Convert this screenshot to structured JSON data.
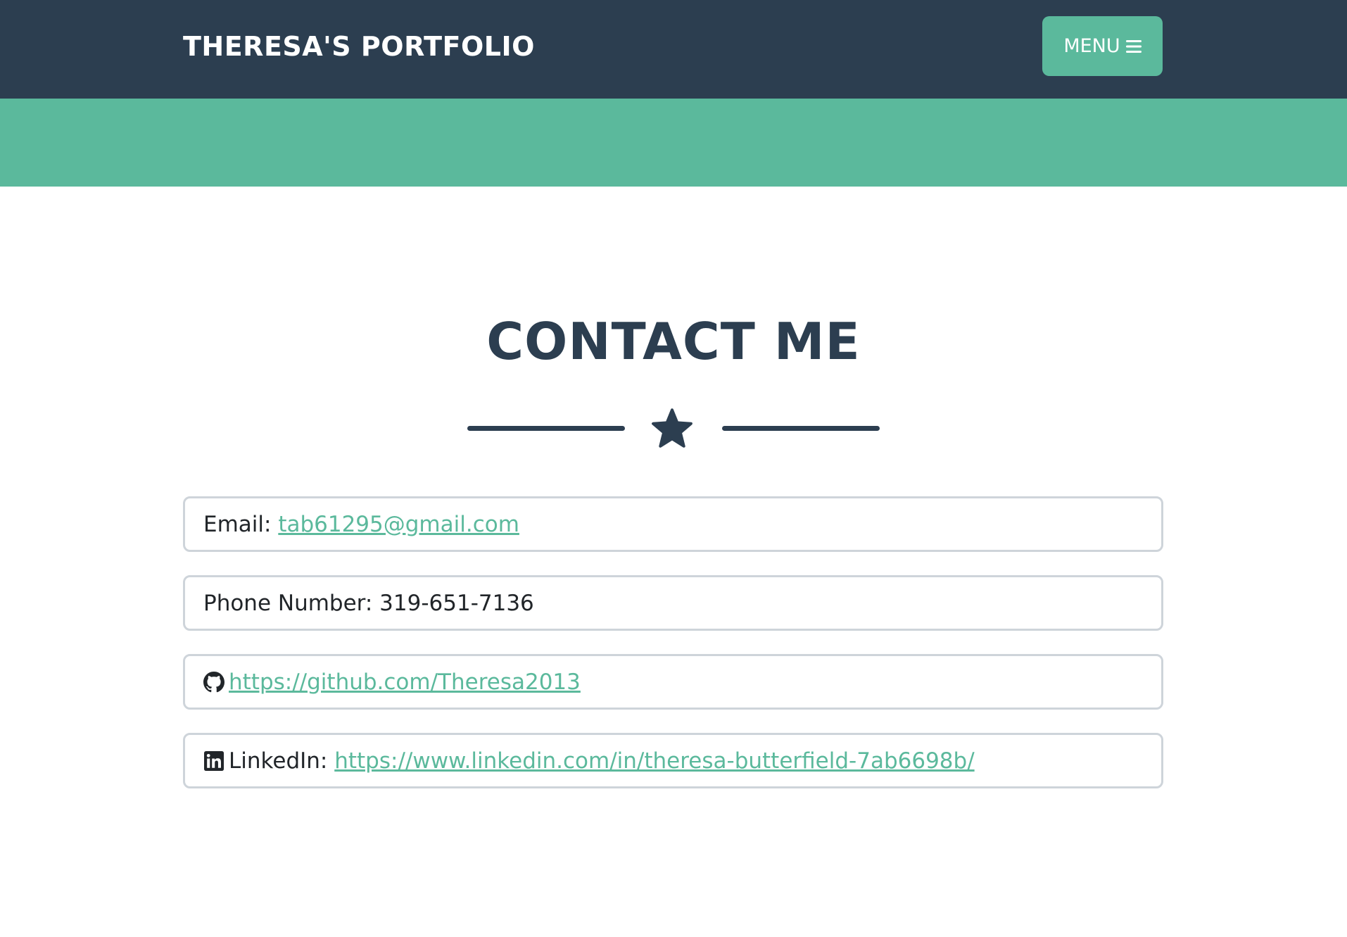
{
  "navbar": {
    "brand": "THERESA'S PORTFOLIO",
    "menu_label": "MENU",
    "menu_icon": "hamburger-icon"
  },
  "colors": {
    "navbar_bg": "#2c3e50",
    "accent": "#5bb99c",
    "title": "#2c3e50",
    "border": "#ced4da"
  },
  "contact": {
    "title": "CONTACT ME",
    "divider_icon": "star-icon",
    "email": {
      "label": "Email: ",
      "value": "tab61295@gmail.com"
    },
    "phone": {
      "label": "Phone Number: ",
      "value": "319-651-7136"
    },
    "github": {
      "icon": "github-icon",
      "url": "https://github.com/Theresa2013"
    },
    "linkedin": {
      "icon": "linkedin-icon",
      "label": "LinkedIn: ",
      "url": "https://www.linkedin.com/in/theresa-butterfield-7ab6698b/"
    }
  }
}
